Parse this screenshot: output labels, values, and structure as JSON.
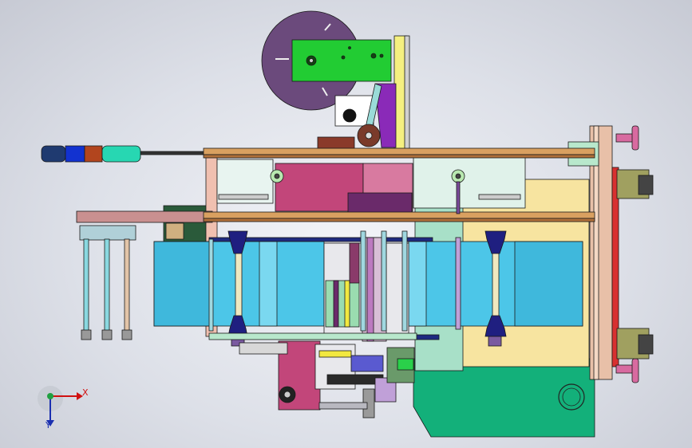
{
  "axes": {
    "x_label": "X",
    "y_label": "Y"
  },
  "colors": {
    "background": "#e3e5ec",
    "disc": "#6b4a7c",
    "panel_green": "#22cc33",
    "frame_tan": "#d9a060",
    "rail_brown": "#b0703a",
    "film_cyan": "#4cc6e8",
    "roller_navy": "#1f1f80",
    "base_teal": "#13b07a",
    "plate_cream": "#f7e4a0",
    "block_magenta": "#c2467a",
    "purple": "#8a2ab8",
    "pink_frame": "#f0c0b0"
  }
}
